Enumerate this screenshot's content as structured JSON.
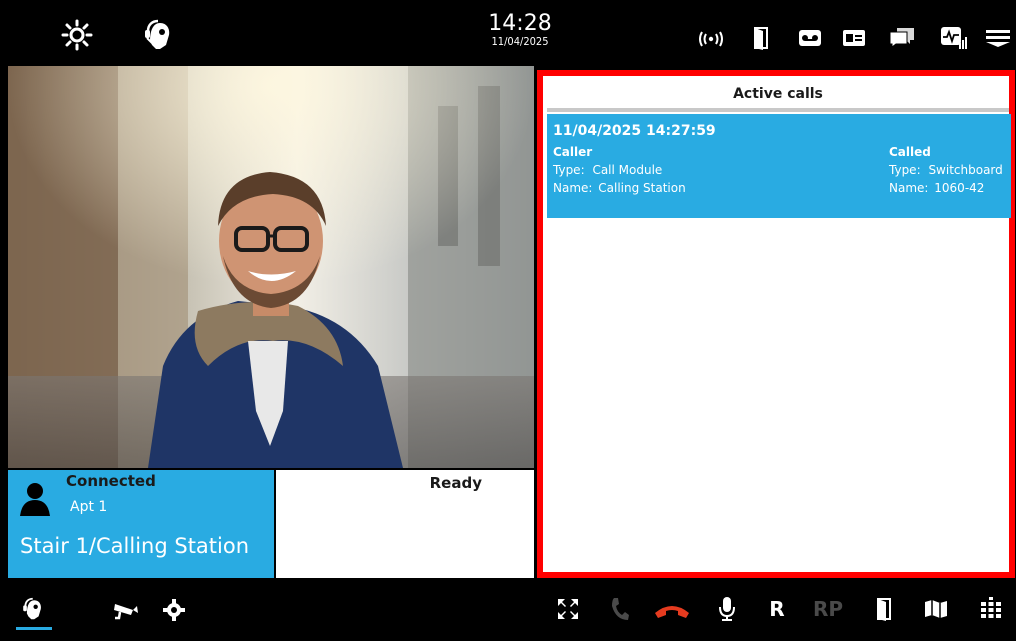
{
  "topbar": {
    "time": "14:28",
    "date": "11/04/2025",
    "icons": [
      "brightness-icon",
      "operator-headset-icon",
      "wireless-signal-icon",
      "door-icon",
      "voicemail-icon",
      "id-card-icon",
      "messages-icon",
      "monitor-signal-icon",
      "menu-icon"
    ]
  },
  "video": {
    "subject": "caller-video-feed"
  },
  "caller_panel": {
    "status": "Connected",
    "apartment": "Apt 1",
    "location": "Stair 1/Calling Station"
  },
  "status_panel": {
    "text": "Ready"
  },
  "active_calls": {
    "title": "Active calls",
    "calls": [
      {
        "datetime": "11/04/2025 14:27:59",
        "caller": {
          "heading": "Caller",
          "type_label": "Type:",
          "type": "Call Module",
          "name_label": "Name:",
          "name": "Calling Station"
        },
        "called": {
          "heading": "Called",
          "type_label": "Type:",
          "type": "Switchboard",
          "name_label": "Name:",
          "name": "1060-42"
        }
      }
    ]
  },
  "bottombar": {
    "icons": [
      "operator-headset-icon",
      "camera-icon",
      "settings-gear-icon",
      "fullscreen-icon",
      "answer-call-icon",
      "hangup-icon",
      "microphone-icon",
      "r-key",
      "rp-key",
      "door-open-icon",
      "map-icon",
      "keypad-icon"
    ],
    "r_label": "R",
    "rp_label": "RP"
  },
  "colors": {
    "accent": "#29abe2",
    "highlight": "#ff0000",
    "hangup": "#e53b1f",
    "background": "#000000"
  }
}
